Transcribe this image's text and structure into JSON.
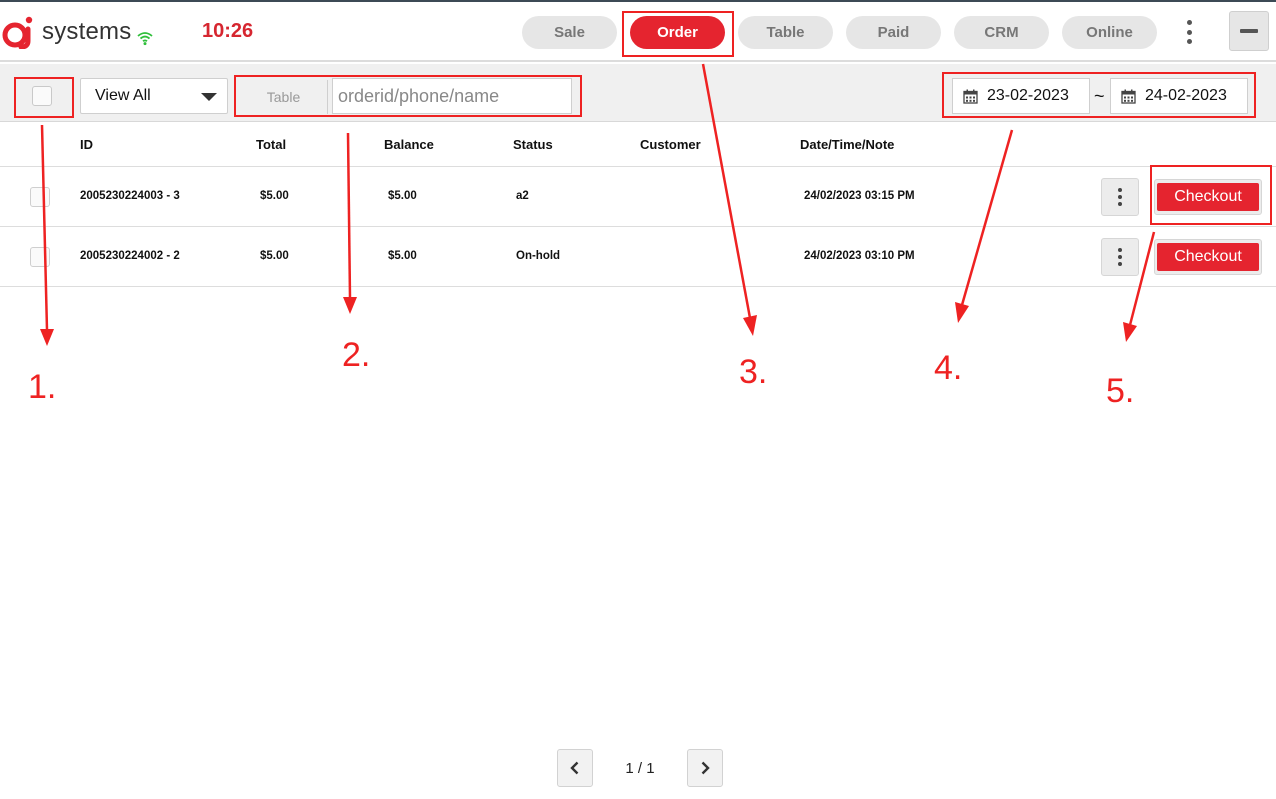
{
  "header": {
    "brand_text": "systems",
    "clock": "10:26",
    "nav": [
      {
        "label": "Sale",
        "active": false
      },
      {
        "label": "Order",
        "active": true
      },
      {
        "label": "Table",
        "active": false
      },
      {
        "label": "Paid",
        "active": false
      },
      {
        "label": "CRM",
        "active": false
      },
      {
        "label": "Online",
        "active": false
      }
    ],
    "icons": [
      "wifi-icon",
      "more-vertical-icon",
      "minimize-icon"
    ]
  },
  "filters": {
    "view_select": "View All",
    "table_label": "Table",
    "search_placeholder": "orderid/phone/name",
    "date_from": "23-02-2023",
    "date_separator": "~",
    "date_to": "24-02-2023"
  },
  "table": {
    "columns": [
      "ID",
      "Total",
      "Balance",
      "Status",
      "Customer",
      "Date/Time/Note"
    ],
    "rows": [
      {
        "id": "2005230224003 - 3",
        "total": "$5.00",
        "balance": "$5.00",
        "status": "a2",
        "customer": "",
        "datetime": "24/02/2023 03:15 PM",
        "action": "Checkout"
      },
      {
        "id": "2005230224002 - 2",
        "total": "$5.00",
        "balance": "$5.00",
        "status": "On-hold",
        "customer": "",
        "datetime": "24/02/2023 03:10 PM",
        "action": "Checkout"
      }
    ]
  },
  "pagination": {
    "label": "1 / 1"
  },
  "annotations": {
    "labels": [
      "1.",
      "2.",
      "3.",
      "4.",
      "5."
    ],
    "color": "#ee2222"
  },
  "colors": {
    "accent": "#e5242f",
    "nav_inactive": "#e6e6e6"
  }
}
